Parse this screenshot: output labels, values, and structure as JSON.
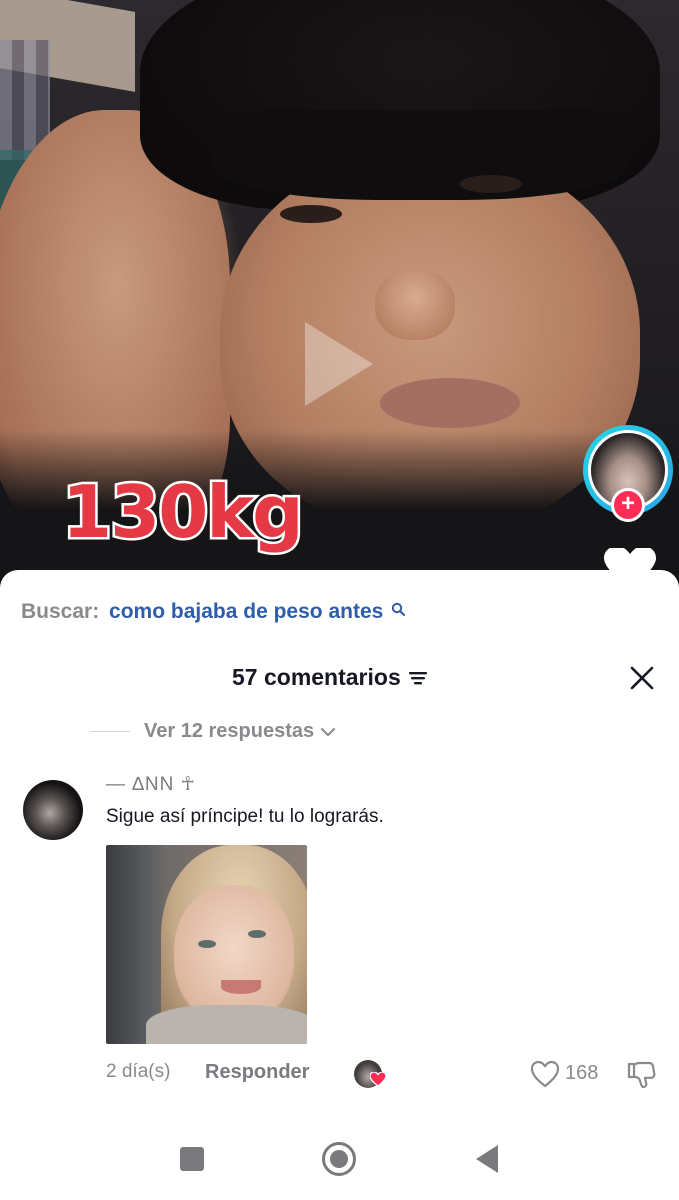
{
  "video": {
    "overlay_text": "130kg",
    "play_icon": "play-icon",
    "creator_avatar_icon": "avatar",
    "follow_label": "+"
  },
  "search": {
    "prefix": "Buscar:",
    "query": "como bajaba de peso antes",
    "icon": "search-icon"
  },
  "comments": {
    "title": "57 comentarios",
    "filter_icon": "filter-icon",
    "close_icon": "close-icon",
    "view_replies": "Ver 12 respuestas",
    "items": [
      {
        "username": "— ∆NN ☥",
        "text": "Sigue así príncipe! tu lo lograrás.",
        "age": "2 día(s)",
        "reply_label": "Responder",
        "likes": "168"
      }
    ]
  },
  "colors": {
    "accent_red": "#ff2c55",
    "link_blue": "#2f5da8",
    "overlay_red": "#e53a46",
    "creator_ring": "#25d6e3"
  }
}
